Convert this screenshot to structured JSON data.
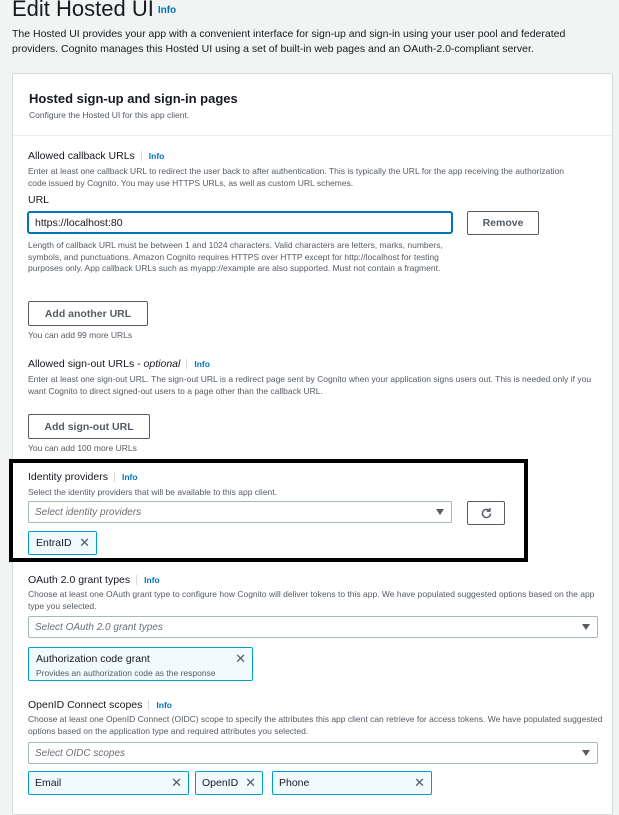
{
  "header": {
    "title": "Edit Hosted UI",
    "info": "Info",
    "description": "The Hosted UI provides your app with a convenient interface for sign-up and sign-in using your user pool and federated providers. Cognito manages this Hosted UI using a set of built-in web pages and an OAuth-2.0-compliant server."
  },
  "panel": {
    "title": "Hosted sign-up and sign-in pages",
    "subtitle": "Configure the Hosted UI for this app client."
  },
  "callback": {
    "label": "Allowed callback URLs",
    "info": "Info",
    "description": "Enter at least one callback URL to redirect the user back to after authentication. This is typically the URL for the app receiving the authorization code issued by Cognito. You may use HTTPS URLs, as well as custom URL schemes.",
    "url_label": "URL",
    "url_value": "https://localhost:80",
    "remove_label": "Remove",
    "constraint": "Length of callback URL must be between 1 and 1024 characters. Valid characters are letters, marks, numbers, symbols, and punctuations. Amazon Cognito requires HTTPS over HTTP except for http://localhost for testing purposes only. App callback URLs such as myapp://example are also supported. Must not contain a fragment.",
    "add_label": "Add another URL",
    "remaining": "You can add 99 more URLs"
  },
  "signout": {
    "label": "Allowed sign-out URLs - ",
    "optional": "optional",
    "info": "Info",
    "description": "Enter at least one sign-out URL. The sign-out URL is a redirect page sent by Cognito when your application signs users out. This is needed only if you want Cognito to direct signed-out users to a page other than the callback URL.",
    "add_label": "Add sign-out URL",
    "remaining": "You can add 100 more URLs"
  },
  "identity": {
    "label": "Identity providers",
    "info": "Info",
    "description": "Select the identity providers that will be available to this app client.",
    "placeholder": "Select identity providers",
    "tokens": [
      "EntraID"
    ]
  },
  "oauth": {
    "label": "OAuth 2.0 grant types",
    "info": "Info",
    "description": "Choose at least one OAuth grant type to configure how Cognito will deliver tokens to this app. We have populated suggested options based on the app type you selected.",
    "placeholder": "Select OAuth 2.0 grant types",
    "token_label": "Authorization code grant",
    "token_desc": "Provides an authorization code as the response"
  },
  "oidc": {
    "label": "OpenID Connect scopes",
    "info": "Info",
    "description": "Choose at least one OpenID Connect (OIDC) scope to specify the attributes this app client can retrieve for access tokens. We have populated suggested options based on the application type and required attributes you selected.",
    "placeholder": "Select OIDC scopes",
    "tokens": [
      "Email",
      "OpenID",
      "Phone"
    ]
  }
}
